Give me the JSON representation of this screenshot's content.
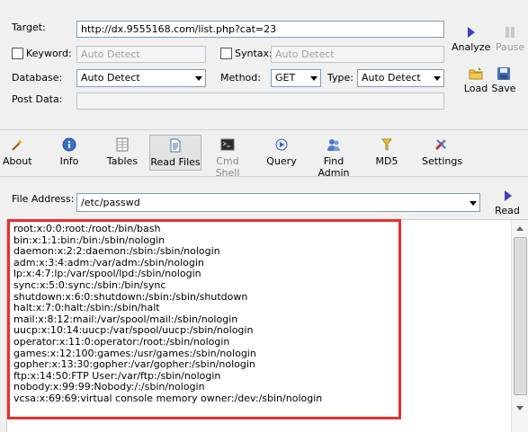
{
  "form": {
    "target_label": "Target:",
    "target_value": "http://dx.9555168.com/list.php?cat=23",
    "keyword_label": "Keyword:",
    "keyword_placeholder": "Auto Detect",
    "syntax_label": "Syntax:",
    "syntax_placeholder": "Auto Detect",
    "database_label": "Database:",
    "database_value": "Auto Detect",
    "method_label": "Method:",
    "method_value": "GET",
    "type_label": "Type:",
    "type_value": "Auto Detect",
    "post_data_label": "Post Data:",
    "post_data_value": ""
  },
  "side_buttons": {
    "analyze": "Analyze",
    "pause": "Pause",
    "load": "Load",
    "save": "Save"
  },
  "toolbar": {
    "about": "About",
    "info": "Info",
    "tables": "Tables",
    "read_files": "Read Files",
    "cmd_shell": "Cmd Shell",
    "query": "Query",
    "find_admin": "Find Admin",
    "md5": "MD5",
    "settings": "Settings"
  },
  "file": {
    "label": "File Address:",
    "value": "/etc/passwd",
    "read_button": "Read"
  },
  "output": {
    "lines": [
      "root:x:0:0:root:/root:/bin/bash",
      "bin:x:1:1:bin:/bin:/sbin/nologin",
      "daemon:x:2:2:daemon:/sbin:/sbin/nologin",
      "adm:x:3:4:adm:/var/adm:/sbin/nologin",
      "lp:x:4:7:lp:/var/spool/lpd:/sbin/nologin",
      "sync:x:5:0:sync:/sbin:/bin/sync",
      "shutdown:x:6:0:shutdown:/sbin:/sbin/shutdown",
      "halt:x:7:0:halt:/sbin:/sbin/halt",
      "mail:x:8:12:mail:/var/spool/mail:/sbin/nologin",
      "uucp:x:10:14:uucp:/var/spool/uucp:/sbin/nologin",
      "operator:x:11:0:operator:/root:/sbin/nologin",
      "games:x:12:100:games:/usr/games:/sbin/nologin",
      "gopher:x:13:30:gopher:/var/gopher:/sbin/nologin",
      "ftp:x:14:50:FTP User:/var/ftp:/sbin/nologin",
      "nobody:x:99:99:Nobody:/:/sbin/nologin",
      "vcsa:x:69:69:virtual console memory owner:/dev:/sbin/nologin"
    ]
  },
  "colors": {
    "highlight_border": "#e83030",
    "analyze_accent": "#3c3ccc"
  }
}
